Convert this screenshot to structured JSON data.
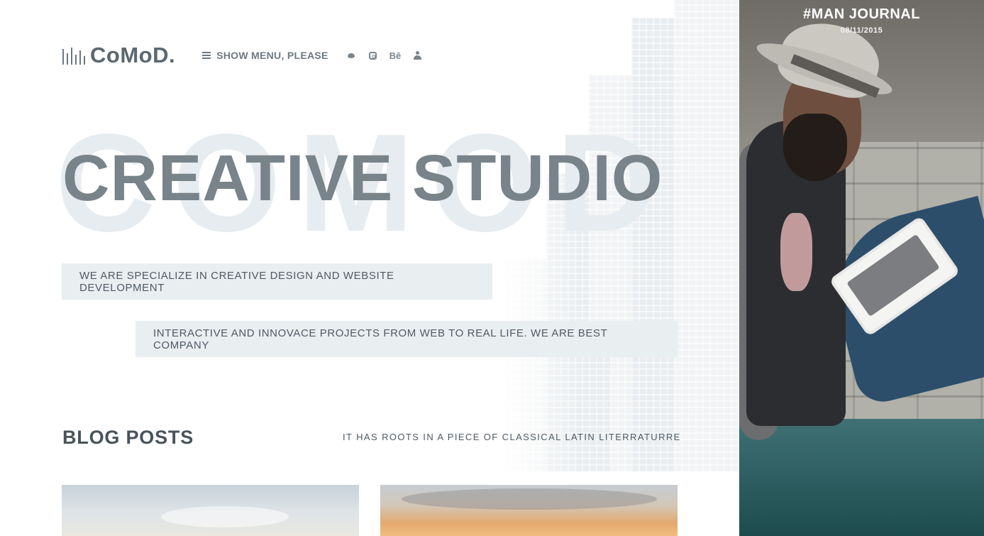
{
  "header": {
    "logo_text": "CoMoD.",
    "menu_label": "SHOW MENU, PLEASE",
    "social": [
      {
        "icon": "twitter-icon"
      },
      {
        "icon": "instagram-icon"
      },
      {
        "icon": "behance-icon",
        "glyph": "Bē"
      },
      {
        "icon": "user-icon"
      }
    ]
  },
  "hero": {
    "background_word": "COMOD",
    "title": "CREATIVE STUDIO",
    "tagline_1": "WE ARE SPECIALIZE IN CREATIVE DESIGN AND WEBSITE DEVELOPMENT",
    "tagline_2": "INTERACTIVE AND INNOVACE PROJECTS FROM WEB TO REAL LIFE. WE ARE BEST COMPANY"
  },
  "blog": {
    "title": "BLOG POSTS",
    "subtitle": "IT HAS ROOTS IN A PIECE OF CLASSICAL LATIN LITERRATURRE"
  },
  "journal": {
    "title": "#MAN JOURNAL",
    "date": "08/11/2015"
  },
  "colors": {
    "accent_text": "#78838a",
    "tag_background": "#e9eef1",
    "background_word": "#e6ecef"
  }
}
